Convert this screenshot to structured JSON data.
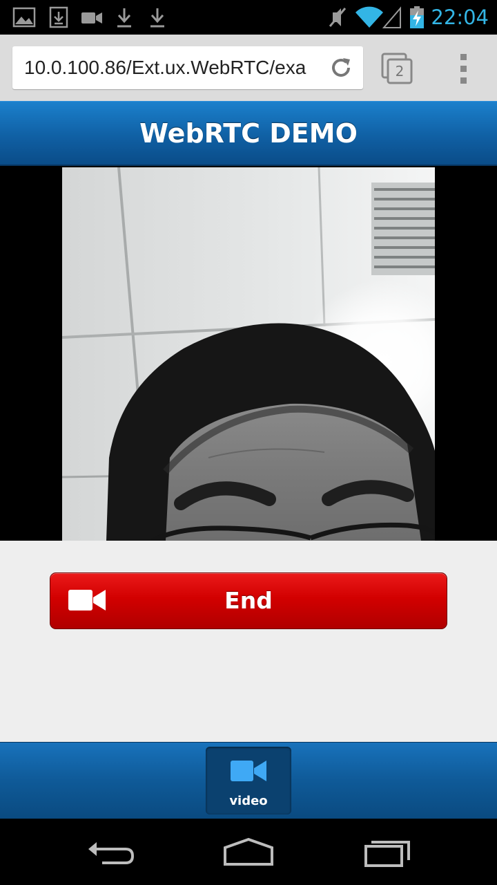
{
  "status_bar": {
    "time": "22:04",
    "notification_icons": [
      "image-icon",
      "download-box-icon",
      "video-camera-icon",
      "download-icon",
      "download-icon"
    ],
    "system_icons": [
      "mute-icon",
      "wifi-icon",
      "signal-icon",
      "battery-charging-icon"
    ],
    "time_color": "#33b5e5"
  },
  "browser": {
    "url": "10.0.100.86/Ext.ux.WebRTC/exa",
    "tab_count": "2",
    "reload_icon": "reload-icon",
    "menu_icon": "overflow-menu-icon"
  },
  "app": {
    "title": "WebRTC DEMO",
    "accent_color": "#1060a4"
  },
  "video": {
    "content": "camera-feed-image"
  },
  "end_button": {
    "label": "End",
    "icon": "video-camera-icon",
    "color": "#d20000"
  },
  "tabbar": {
    "tabs": [
      {
        "label": "video",
        "icon": "video-camera-icon",
        "active": true,
        "icon_color": "#3fa9f5"
      }
    ]
  },
  "nav_bar": {
    "buttons": [
      "back-icon",
      "home-icon",
      "recent-apps-icon"
    ]
  }
}
